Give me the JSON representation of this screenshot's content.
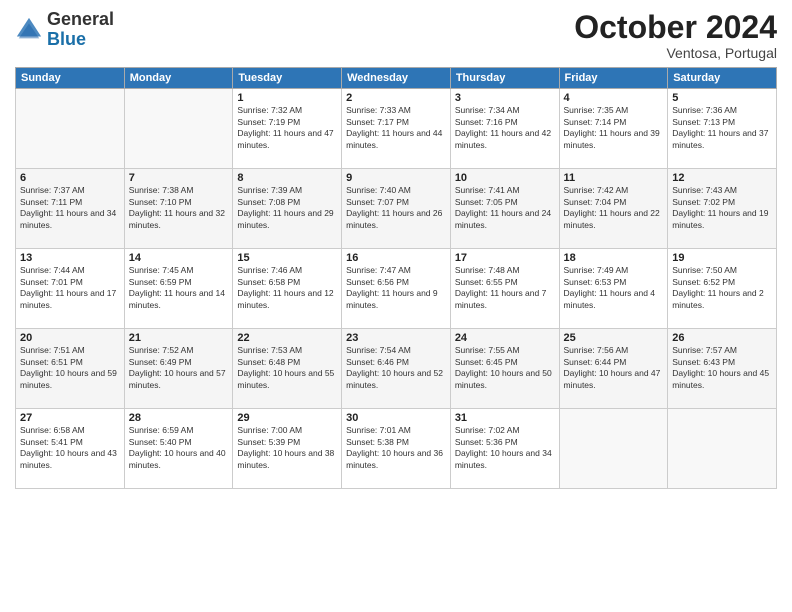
{
  "header": {
    "logo_general": "General",
    "logo_blue": "Blue",
    "month": "October 2024",
    "location": "Ventosa, Portugal"
  },
  "days_of_week": [
    "Sunday",
    "Monday",
    "Tuesday",
    "Wednesday",
    "Thursday",
    "Friday",
    "Saturday"
  ],
  "weeks": [
    [
      {
        "day": "",
        "info": ""
      },
      {
        "day": "",
        "info": ""
      },
      {
        "day": "1",
        "info": "Sunrise: 7:32 AM\nSunset: 7:19 PM\nDaylight: 11 hours and 47 minutes."
      },
      {
        "day": "2",
        "info": "Sunrise: 7:33 AM\nSunset: 7:17 PM\nDaylight: 11 hours and 44 minutes."
      },
      {
        "day": "3",
        "info": "Sunrise: 7:34 AM\nSunset: 7:16 PM\nDaylight: 11 hours and 42 minutes."
      },
      {
        "day": "4",
        "info": "Sunrise: 7:35 AM\nSunset: 7:14 PM\nDaylight: 11 hours and 39 minutes."
      },
      {
        "day": "5",
        "info": "Sunrise: 7:36 AM\nSunset: 7:13 PM\nDaylight: 11 hours and 37 minutes."
      }
    ],
    [
      {
        "day": "6",
        "info": "Sunrise: 7:37 AM\nSunset: 7:11 PM\nDaylight: 11 hours and 34 minutes."
      },
      {
        "day": "7",
        "info": "Sunrise: 7:38 AM\nSunset: 7:10 PM\nDaylight: 11 hours and 32 minutes."
      },
      {
        "day": "8",
        "info": "Sunrise: 7:39 AM\nSunset: 7:08 PM\nDaylight: 11 hours and 29 minutes."
      },
      {
        "day": "9",
        "info": "Sunrise: 7:40 AM\nSunset: 7:07 PM\nDaylight: 11 hours and 26 minutes."
      },
      {
        "day": "10",
        "info": "Sunrise: 7:41 AM\nSunset: 7:05 PM\nDaylight: 11 hours and 24 minutes."
      },
      {
        "day": "11",
        "info": "Sunrise: 7:42 AM\nSunset: 7:04 PM\nDaylight: 11 hours and 22 minutes."
      },
      {
        "day": "12",
        "info": "Sunrise: 7:43 AM\nSunset: 7:02 PM\nDaylight: 11 hours and 19 minutes."
      }
    ],
    [
      {
        "day": "13",
        "info": "Sunrise: 7:44 AM\nSunset: 7:01 PM\nDaylight: 11 hours and 17 minutes."
      },
      {
        "day": "14",
        "info": "Sunrise: 7:45 AM\nSunset: 6:59 PM\nDaylight: 11 hours and 14 minutes."
      },
      {
        "day": "15",
        "info": "Sunrise: 7:46 AM\nSunset: 6:58 PM\nDaylight: 11 hours and 12 minutes."
      },
      {
        "day": "16",
        "info": "Sunrise: 7:47 AM\nSunset: 6:56 PM\nDaylight: 11 hours and 9 minutes."
      },
      {
        "day": "17",
        "info": "Sunrise: 7:48 AM\nSunset: 6:55 PM\nDaylight: 11 hours and 7 minutes."
      },
      {
        "day": "18",
        "info": "Sunrise: 7:49 AM\nSunset: 6:53 PM\nDaylight: 11 hours and 4 minutes."
      },
      {
        "day": "19",
        "info": "Sunrise: 7:50 AM\nSunset: 6:52 PM\nDaylight: 11 hours and 2 minutes."
      }
    ],
    [
      {
        "day": "20",
        "info": "Sunrise: 7:51 AM\nSunset: 6:51 PM\nDaylight: 10 hours and 59 minutes."
      },
      {
        "day": "21",
        "info": "Sunrise: 7:52 AM\nSunset: 6:49 PM\nDaylight: 10 hours and 57 minutes."
      },
      {
        "day": "22",
        "info": "Sunrise: 7:53 AM\nSunset: 6:48 PM\nDaylight: 10 hours and 55 minutes."
      },
      {
        "day": "23",
        "info": "Sunrise: 7:54 AM\nSunset: 6:46 PM\nDaylight: 10 hours and 52 minutes."
      },
      {
        "day": "24",
        "info": "Sunrise: 7:55 AM\nSunset: 6:45 PM\nDaylight: 10 hours and 50 minutes."
      },
      {
        "day": "25",
        "info": "Sunrise: 7:56 AM\nSunset: 6:44 PM\nDaylight: 10 hours and 47 minutes."
      },
      {
        "day": "26",
        "info": "Sunrise: 7:57 AM\nSunset: 6:43 PM\nDaylight: 10 hours and 45 minutes."
      }
    ],
    [
      {
        "day": "27",
        "info": "Sunrise: 6:58 AM\nSunset: 5:41 PM\nDaylight: 10 hours and 43 minutes."
      },
      {
        "day": "28",
        "info": "Sunrise: 6:59 AM\nSunset: 5:40 PM\nDaylight: 10 hours and 40 minutes."
      },
      {
        "day": "29",
        "info": "Sunrise: 7:00 AM\nSunset: 5:39 PM\nDaylight: 10 hours and 38 minutes."
      },
      {
        "day": "30",
        "info": "Sunrise: 7:01 AM\nSunset: 5:38 PM\nDaylight: 10 hours and 36 minutes."
      },
      {
        "day": "31",
        "info": "Sunrise: 7:02 AM\nSunset: 5:36 PM\nDaylight: 10 hours and 34 minutes."
      },
      {
        "day": "",
        "info": ""
      },
      {
        "day": "",
        "info": ""
      }
    ]
  ]
}
